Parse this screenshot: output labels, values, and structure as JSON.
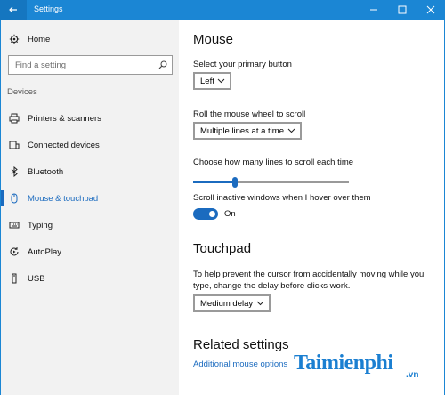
{
  "window": {
    "title": "Settings"
  },
  "sidebar": {
    "home": {
      "label": "Home",
      "icon": "gear-icon"
    },
    "search": {
      "placeholder": "Find a setting",
      "icon": "search-icon"
    },
    "section_label": "Devices",
    "items": [
      {
        "label": "Printers & scanners",
        "icon": "printer-icon"
      },
      {
        "label": "Connected devices",
        "icon": "connected-devices-icon"
      },
      {
        "label": "Bluetooth",
        "icon": "bluetooth-icon"
      },
      {
        "label": "Mouse & touchpad",
        "icon": "mouse-icon",
        "active": true
      },
      {
        "label": "Typing",
        "icon": "keyboard-icon"
      },
      {
        "label": "AutoPlay",
        "icon": "autoplay-icon"
      },
      {
        "label": "USB",
        "icon": "usb-icon"
      }
    ]
  },
  "mouse": {
    "heading": "Mouse",
    "primary_button": {
      "label": "Select your primary button",
      "value": "Left"
    },
    "wheel": {
      "label": "Roll the mouse wheel to scroll",
      "value": "Multiple lines at a time"
    },
    "lines": {
      "label": "Choose how many lines to scroll each time",
      "value_fraction": 0.27
    },
    "inactive": {
      "label": "Scroll inactive windows when I hover over them",
      "state": "On"
    }
  },
  "touchpad": {
    "heading": "Touchpad",
    "desc_line1": "To help prevent the cursor from accidentally moving while you",
    "desc_line2": "type, change the delay before clicks work.",
    "delay_value": "Medium delay"
  },
  "related": {
    "heading": "Related settings",
    "link": "Additional mouse options"
  },
  "watermark": {
    "brand": "Taimienphi",
    "tld": ".vn"
  },
  "colors": {
    "accent": "#1b6bbf",
    "titlebar": "#1b86d4"
  }
}
